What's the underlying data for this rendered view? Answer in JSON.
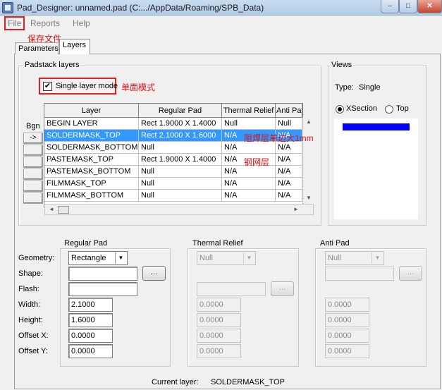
{
  "window": {
    "title": "Pad_Designer: unnamed.pad (C:.../AppData/Roaming/SPB_Data)",
    "controls": {
      "minimize": "–",
      "maximize": "□",
      "close": "✕"
    }
  },
  "menu": {
    "file": "File",
    "reports": "Reports",
    "help": "Help"
  },
  "annotations": {
    "save_file": "保存文件",
    "single_mode": "单面模式",
    "soldermask_note": "阻焊层单边大1mm",
    "paste_note": "钢网层"
  },
  "tabs": {
    "parameters": "Parameters",
    "layers": "Layers",
    "active": "Layers"
  },
  "padstack": {
    "title": "Padstack layers",
    "single_layer_mode": {
      "label": "Single layer mode",
      "checked": true,
      "mark": "✔"
    },
    "bgn_label": "Bgn",
    "columns": [
      "Layer",
      "Regular Pad",
      "Thermal Relief",
      "Anti Pad"
    ],
    "rows": [
      {
        "button": "",
        "layer": "BEGIN LAYER",
        "regular": "Rect 1.9000 X 1.4000",
        "thermal": "Null",
        "anti": "Null"
      },
      {
        "button": "->",
        "layer": "SOLDERMASK_TOP",
        "regular": "Rect 2.1000 X 1.6000",
        "thermal": "N/A",
        "anti": "N/A",
        "selected": true
      },
      {
        "button": "",
        "layer": "SOLDERMASK_BOTTOM",
        "regular": "Null",
        "thermal": "N/A",
        "anti": "N/A"
      },
      {
        "button": "",
        "layer": "PASTEMASK_TOP",
        "regular": "Rect 1.9000 X 1.4000",
        "thermal": "N/A",
        "anti": "N/A"
      },
      {
        "button": "",
        "layer": "PASTEMASK_BOTTOM",
        "regular": "Null",
        "thermal": "N/A",
        "anti": "N/A"
      },
      {
        "button": "",
        "layer": "FILMMASK_TOP",
        "regular": "Null",
        "thermal": "N/A",
        "anti": "N/A"
      },
      {
        "button": "",
        "layer": "FILMMASK_BOTTOM",
        "regular": "Null",
        "thermal": "N/A",
        "anti": "N/A"
      }
    ]
  },
  "views": {
    "title": "Views",
    "type_label": "Type:",
    "type_value": "Single",
    "xsection": "XSection",
    "top": "Top",
    "selected": "XSection",
    "pad_color": "#0000ff"
  },
  "labels": {
    "geometry": "Geometry:",
    "shape": "Shape:",
    "flash": "Flash:",
    "width": "Width:",
    "height": "Height:",
    "offset_x": "Offset X:",
    "offset_y": "Offset Y:"
  },
  "regular_pad": {
    "title": "Regular Pad",
    "geometry": "Rectangle",
    "shape": "",
    "flash": "",
    "browse": "...",
    "width": "2.1000",
    "height": "1.6000",
    "offset_x": "0.0000",
    "offset_y": "0.0000"
  },
  "thermal_relief": {
    "title": "Thermal Relief",
    "geometry": "Null",
    "flash": "",
    "browse": "...",
    "width": "0.0000",
    "height": "0.0000",
    "offset_x": "0.0000",
    "offset_y": "0.0000"
  },
  "anti_pad": {
    "title": "Anti Pad",
    "geometry": "Null",
    "shape": "",
    "browse": "...",
    "width": "0.0000",
    "height": "0.0000",
    "offset_x": "0.0000",
    "offset_y": "0.0000"
  },
  "status": {
    "current_layer_label": "Current layer:",
    "current_layer": "SOLDERMASK_TOP"
  },
  "scroll": {
    "up": "▲",
    "down": "▼",
    "left": "◄",
    "right": "►",
    "dropdown": "▼"
  },
  "colors": {
    "selection": "#3399ff",
    "annotation": "#e01010"
  }
}
